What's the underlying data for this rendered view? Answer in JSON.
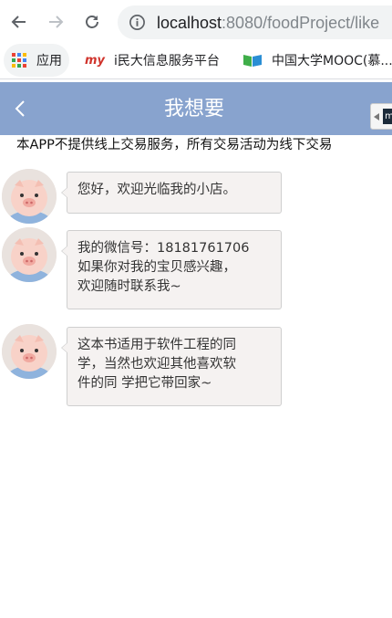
{
  "browser": {
    "url_host": "localhost",
    "url_path": ":8080/foodProject/like",
    "bookmarks": [
      {
        "label": "应用",
        "icon": "apps-grid-icon"
      },
      {
        "label": "i民大信息服务平台",
        "icon": "my-logo-icon"
      },
      {
        "label": "中国大学MOOC(慕...",
        "icon": "mooc-logo-icon"
      }
    ]
  },
  "header": {
    "title": "我想要",
    "background": "#88a3ce"
  },
  "notice": "本APP不提供线上交易服务，所有交易活动为线下交易",
  "messages": [
    {
      "lines": [
        "您好，欢迎光临我的小店。"
      ]
    },
    {
      "lines": [
        "我的微信号：18181761706",
        "如果你对我的宝贝感兴趣，",
        "欢迎随时联系我~"
      ]
    },
    {
      "lines": [
        "这本书适用于软件工程的同",
        "学，当然也欢迎其他喜欢软",
        "件的同 学把它带回家~"
      ]
    }
  ]
}
